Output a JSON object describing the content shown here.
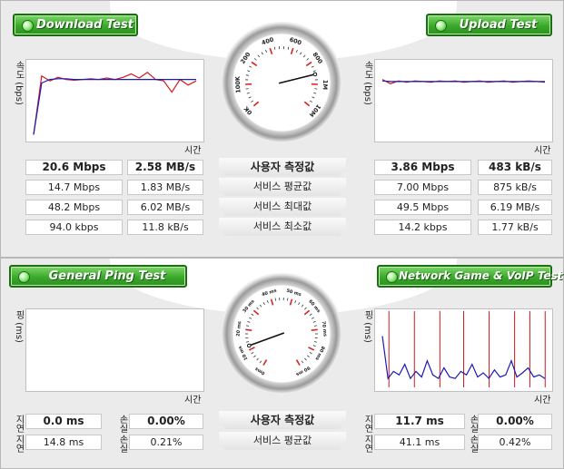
{
  "download": {
    "title": "Download Test",
    "ylabel": "속도 (bps)",
    "xlabel": "시간"
  },
  "upload": {
    "title": "Upload Test",
    "ylabel": "속도 (bps)",
    "xlabel": "시간"
  },
  "ping": {
    "title": "General Ping Test",
    "ylabel": "핑 (ms)",
    "xlabel": "시간"
  },
  "game": {
    "title": "Network Game & VoIP Test",
    "ylabel": "핑 (ms)",
    "xlabel": "시간"
  },
  "speed_gauge": {
    "labels": [
      "0K",
      "100K",
      "200",
      "400",
      "600",
      "800",
      "1M",
      "10M"
    ],
    "needle_value": "1M"
  },
  "ping_gauge": {
    "labels": [
      "0ms",
      "10 ms",
      "20 ms",
      "30 ms",
      "40 ms",
      "50 ms",
      "60 ms",
      "70 ms",
      "80 ms",
      "90 ms"
    ],
    "needle_value": "10 ms"
  },
  "speed_rows": [
    {
      "label": "사용자 측정값",
      "bold": true,
      "dl_mbps": "20.6 Mbps",
      "dl_mbs": "2.58 MB/s",
      "ul_mbps": "3.86 Mbps",
      "ul_kbs": "483 kB/s"
    },
    {
      "label": "서비스 평균값",
      "bold": false,
      "dl_mbps": "14.7 Mbps",
      "dl_mbs": "1.83 MB/s",
      "ul_mbps": "7.00 Mbps",
      "ul_kbs": "875 kB/s"
    },
    {
      "label": "서비스 최대값",
      "bold": false,
      "dl_mbps": "48.2 Mbps",
      "dl_mbs": "6.02 MB/s",
      "ul_mbps": "49.5 Mbps",
      "ul_kbs": "6.19 MB/s"
    },
    {
      "label": "서비스 최소값",
      "bold": false,
      "dl_mbps": "94.0 kbps",
      "dl_mbs": "11.8 kB/s",
      "ul_mbps": "14.2 kbps",
      "ul_kbs": "1.77 kB/s"
    }
  ],
  "ping_rows": [
    {
      "label": "사용자 측정값",
      "bold": true,
      "ping_delay": "0.0 ms",
      "ping_loss": "0.00%",
      "game_delay": "11.7 ms",
      "game_loss": "0.00%"
    },
    {
      "label": "서비스 평균값",
      "bold": false,
      "ping_delay": "14.8 ms",
      "ping_loss": "0.21%",
      "game_delay": "41.1 ms",
      "game_loss": "0.42%"
    }
  ],
  "side_labels": {
    "delay": "지연",
    "loss": "손실"
  },
  "colors": {
    "button_green": "#3aa92a",
    "series_red": "#d11a1a",
    "series_blue": "#1a1ab8"
  },
  "chart_data": [
    {
      "type": "line",
      "title": "Download Test",
      "xlabel": "시간",
      "ylabel": "속도 (bps)",
      "series": [
        {
          "color": "#d11a1a",
          "values": [
            0.02,
            0.85,
            0.78,
            0.83,
            0.8,
            0.79,
            0.8,
            0.81,
            0.8,
            0.82,
            0.8,
            0.83,
            0.88,
            0.82,
            0.9,
            0.8,
            0.78,
            0.62,
            0.8,
            0.72,
            0.78
          ]
        },
        {
          "color": "#1a1ab8",
          "values": [
            0.02,
            0.75,
            0.8,
            0.81,
            0.81,
            0.8,
            0.8,
            0.8,
            0.8,
            0.8,
            0.8,
            0.8,
            0.8,
            0.8,
            0.8,
            0.8,
            0.8,
            0.8,
            0.8,
            0.8,
            0.8
          ]
        }
      ]
    },
    {
      "type": "line",
      "title": "Upload Test",
      "xlabel": "시간",
      "ylabel": "속도 (bps)",
      "series": [
        {
          "color": "#d11a1a",
          "values": [
            0.8,
            0.74,
            0.78,
            0.76,
            0.78,
            0.77,
            0.76,
            0.78,
            0.77,
            0.78,
            0.76,
            0.77,
            0.78,
            0.76,
            0.77,
            0.78,
            0.76,
            0.77,
            0.78,
            0.77,
            0.76
          ]
        },
        {
          "color": "#1a1ab8",
          "values": [
            0.78,
            0.77,
            0.77,
            0.77,
            0.77,
            0.77,
            0.77,
            0.77,
            0.77,
            0.77,
            0.77,
            0.77,
            0.77,
            0.77,
            0.77,
            0.77,
            0.77,
            0.77,
            0.77,
            0.77,
            0.77
          ]
        }
      ]
    },
    {
      "type": "line",
      "title": "General Ping Test",
      "xlabel": "시간",
      "ylabel": "핑 (ms)",
      "series": []
    },
    {
      "type": "line",
      "title": "Network Game & VoIP Test",
      "xlabel": "시간",
      "ylabel": "핑 (ms)",
      "series": [
        {
          "color": "#1a1ab8",
          "values": [
            0.7,
            0.1,
            0.2,
            0.15,
            0.3,
            0.1,
            0.2,
            0.12,
            0.35,
            0.15,
            0.1,
            0.25,
            0.12,
            0.1,
            0.2,
            0.15,
            0.3,
            0.12,
            0.18,
            0.1,
            0.22,
            0.12,
            0.15,
            0.35,
            0.12,
            0.18,
            0.25,
            0.12,
            0.15,
            0.1
          ]
        }
      ],
      "spikes": [
        0.06,
        0.21,
        0.36,
        0.5,
        0.65,
        0.8,
        0.89,
        0.98
      ]
    }
  ]
}
